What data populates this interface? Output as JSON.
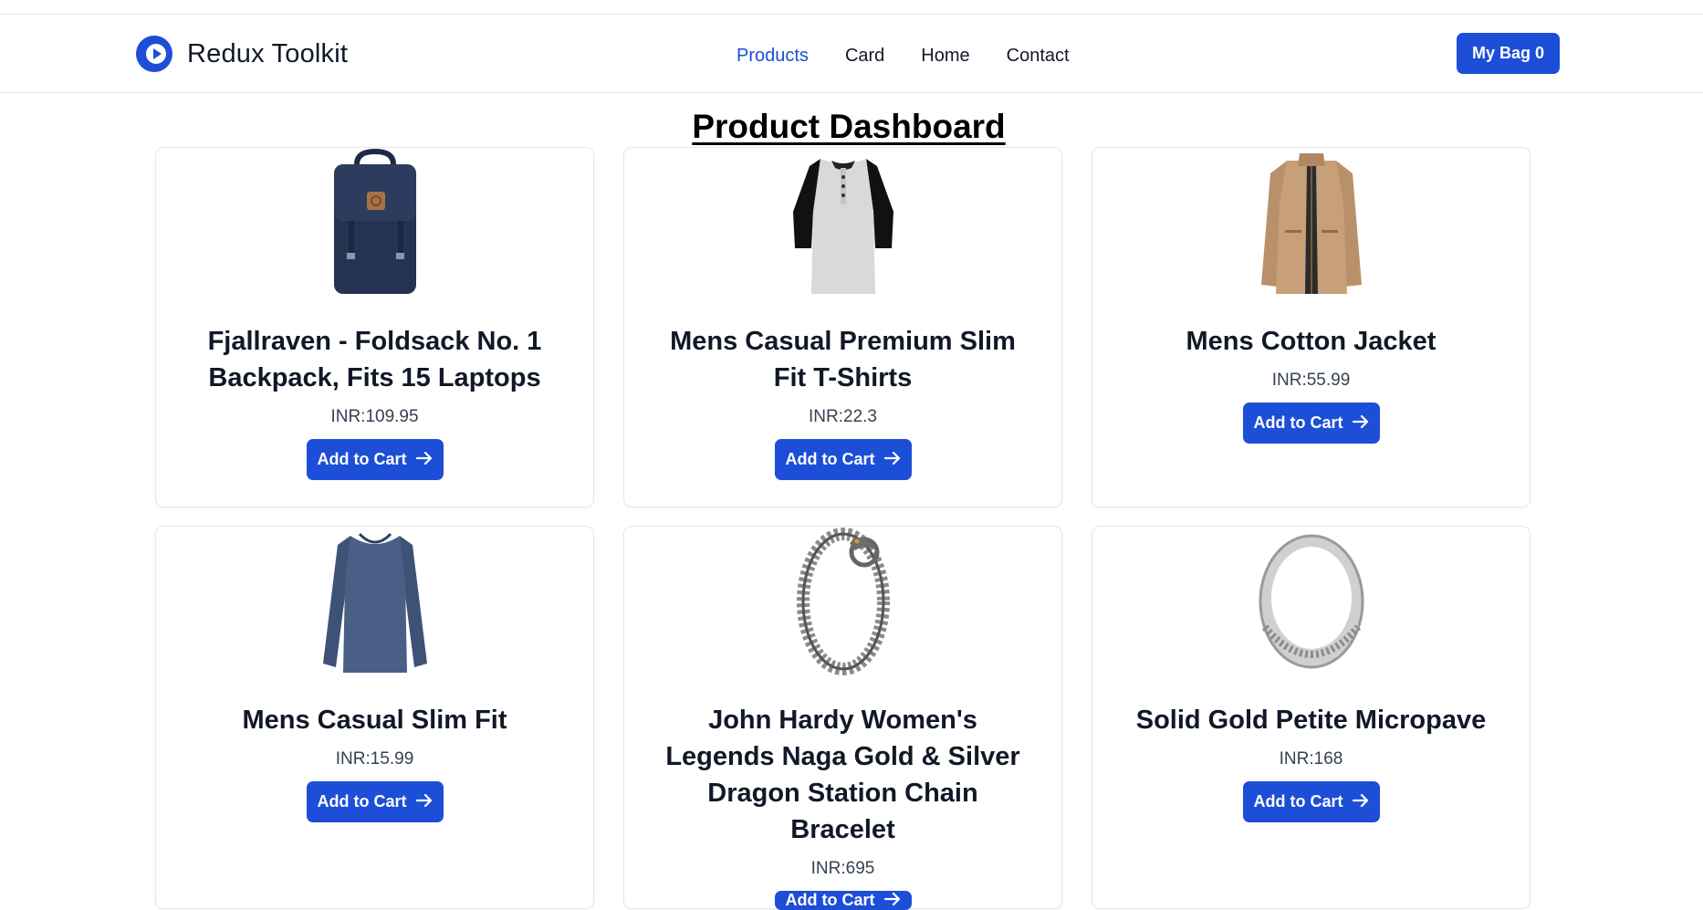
{
  "header": {
    "brand_name": "Redux Toolkit",
    "nav": [
      "Products",
      "Card",
      "Home",
      "Contact"
    ],
    "active_nav": "Products",
    "bag_label": "My Bag",
    "bag_count": "0"
  },
  "main": {
    "title": "Product Dashboard",
    "button_label": "Add to Cart",
    "products": [
      {
        "title": "Fjallraven - Foldsack No. 1 Backpack, Fits 15 Laptops",
        "price": "INR:109.95",
        "image": "backpack"
      },
      {
        "title": "Mens Casual Premium Slim Fit T-Shirts",
        "price": "INR:22.3",
        "image": "raglan-tshirt"
      },
      {
        "title": "Mens Cotton Jacket",
        "price": "INR:55.99",
        "image": "jacket"
      },
      {
        "title": "Mens Casual Slim Fit",
        "price": "INR:15.99",
        "image": "long-sleeve-shirt"
      },
      {
        "title": "John Hardy Women's Legends Naga Gold & Silver Dragon Station Chain Bracelet",
        "price": "INR:695",
        "image": "bracelet"
      },
      {
        "title": "Solid Gold Petite Micropave",
        "price": "INR:168",
        "image": "ring"
      }
    ]
  },
  "colors": {
    "accent": "#1d4ed8",
    "text": "#111827",
    "border": "#e5e7eb"
  }
}
